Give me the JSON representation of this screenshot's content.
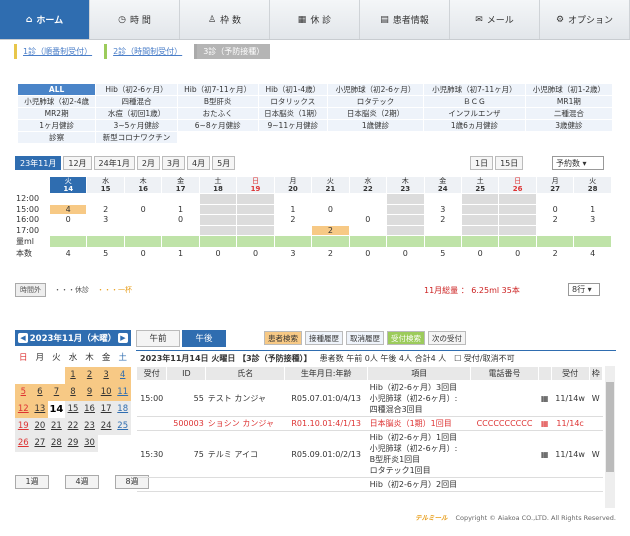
{
  "nav": [
    "ホーム",
    "時 間",
    "枠 数",
    "休 診",
    "患者情報",
    "メール",
    "オプション"
  ],
  "nav_icons": [
    "home-icon",
    "clock-icon",
    "person-icon",
    "calendar-icon",
    "card-icon",
    "mail-icon",
    "gear-icon"
  ],
  "subtabs": [
    "1診（順番制受付）",
    "2診（時間制受付）",
    "3診（予防接種）"
  ],
  "vaccines": [
    [
      "ALL",
      "Hib（初2-6ヶ月）",
      "Hib（初7-11ヶ月）",
      "Hib（初1-4歳）",
      "小児肺球（初2-6ヶ月）",
      "小児肺球（初7-11ヶ月）",
      "小児肺球（初1-2歳）"
    ],
    [
      "小児肺球（初2-4歳",
      "四種混合",
      "B型肝炎",
      "ロタリックス",
      "ロタテック",
      "ＢＣＧ",
      "MR1期"
    ],
    [
      "MR2期",
      "水痘（初回1歳）",
      "おたふく",
      "日本脳炎（1期）",
      "日本脳炎（2期）",
      "インフルエンザ",
      "二種混合"
    ],
    [
      "1ヶ月健診",
      "3~5ヶ月健診",
      "6~8ヶ月健診",
      "9~11ヶ月健診",
      "1歳健診",
      "1歳6ヵ月健診",
      "3歳健診"
    ],
    [
      "診察",
      "新型コロナワクチン",
      "",
      "",
      "",
      "",
      ""
    ]
  ],
  "months": [
    "23年11月",
    "12月",
    "24年1月",
    "2月",
    "3月",
    "4月",
    "5月"
  ],
  "range_buttons": [
    "1日",
    "15日"
  ],
  "view_select": "予約数",
  "sched_days": [
    {
      "w": "火",
      "d": "14"
    },
    {
      "w": "水",
      "d": "15"
    },
    {
      "w": "木",
      "d": "16"
    },
    {
      "w": "金",
      "d": "17"
    },
    {
      "w": "土",
      "d": "18"
    },
    {
      "w": "日",
      "d": "19"
    },
    {
      "w": "月",
      "d": "20"
    },
    {
      "w": "火",
      "d": "21"
    },
    {
      "w": "水",
      "d": "22"
    },
    {
      "w": "木",
      "d": "23"
    },
    {
      "w": "金",
      "d": "24"
    },
    {
      "w": "土",
      "d": "25"
    },
    {
      "w": "日",
      "d": "26"
    },
    {
      "w": "月",
      "d": "27"
    },
    {
      "w": "火",
      "d": "28"
    }
  ],
  "sched_rows": [
    {
      "t": "12:00",
      "v": [
        "",
        "",
        "",
        "",
        "",
        "",
        "",
        "",
        "",
        "",
        "",
        "",
        "",
        "",
        ""
      ]
    },
    {
      "t": "15:00",
      "v": [
        "4",
        "2",
        "0",
        "1",
        "",
        "",
        "1",
        "0",
        "",
        "",
        "3",
        "",
        "",
        "0",
        "1"
      ]
    },
    {
      "t": "16:00",
      "v": [
        "0",
        "3",
        "",
        "0",
        "",
        "",
        "2",
        "",
        "0",
        "",
        "2",
        "",
        "",
        "2",
        "3"
      ]
    },
    {
      "t": "17:00",
      "v": [
        "",
        "",
        "",
        "",
        "",
        "",
        "",
        "2",
        "",
        "",
        "",
        "",
        "",
        "",
        ""
      ]
    },
    {
      "t": "量ml",
      "v": [
        "",
        "",
        "",
        "",
        "",
        "",
        "",
        "",
        "",
        "",
        "",
        "",
        "",
        "",
        ""
      ]
    },
    {
      "t": "本数",
      "v": [
        "4",
        "5",
        "0",
        "1",
        "0",
        "0",
        "3",
        "2",
        "0",
        "0",
        "5",
        "0",
        "0",
        "2",
        "4"
      ]
    }
  ],
  "legend": [
    "時間外",
    "・・・休診",
    "・・・一杯"
  ],
  "total": "11月総量 ： 6.25ml 35本",
  "row_select": "8行",
  "calendar": {
    "title": "2023年11月（木曜）",
    "weekdays": [
      "日",
      "月",
      "火",
      "水",
      "木",
      "金",
      "土"
    ],
    "days": [
      "",
      "",
      "",
      "1",
      "2",
      "3",
      "4",
      "5",
      "6",
      "7",
      "8",
      "9",
      "10",
      "11",
      "12",
      "13",
      "14",
      "15",
      "16",
      "17",
      "18",
      "19",
      "20",
      "21",
      "22",
      "23",
      "24",
      "25",
      "26",
      "27",
      "28",
      "29",
      "30",
      "",
      ""
    ]
  },
  "cal_buttons": [
    "1週",
    "4週",
    "8週"
  ],
  "period_tabs": [
    "午前",
    "午後"
  ],
  "history_buttons": [
    "患者検索",
    "接種履歴",
    "取消履歴",
    "受付検索",
    "次の受付"
  ],
  "info": {
    "date": "2023年11月14日 火曜日 【3診（予防接種）】",
    "count": "患者数 午前 0人 午後 4人 合計4 人",
    "checkbox": "受付/取消不可"
  },
  "table_headers": [
    "受付",
    "ID",
    "氏名",
    "生年月日:年齢",
    "項目",
    "電話番号",
    "",
    "受付",
    "枠"
  ],
  "patients": [
    {
      "time": "15:00",
      "id": "55",
      "name": "テスト カンジャ",
      "birth": "R05.07.01:0/4/13",
      "items": [
        "Hib（初2-6ヶ月）3回目",
        "小児肺球（初2-6ヶ月）:",
        "四種混合3回目"
      ],
      "tel": "",
      "rec": "11/14w",
      "w": "W",
      "red": false
    },
    {
      "time": "",
      "id": "500003",
      "name": "ショシン カンジャ",
      "birth": "R01.10.01:4/1/13",
      "items": [
        "日本脳炎（1期）1回目"
      ],
      "tel": "CCCCCCCCCC",
      "rec": "11/14c",
      "w": "",
      "red": true
    },
    {
      "time": "15:30",
      "id": "75",
      "name": "テルミ アイコ",
      "birth": "R05.09.01:0/2/13",
      "items": [
        "Hib（初2-6ヶ月）1回目",
        "小児肺球（初2-6ヶ月）:",
        "B型肝炎1回目",
        "ロタテック1回目"
      ],
      "tel": "",
      "rec": "11/14w",
      "w": "W",
      "red": false
    },
    {
      "time": "",
      "id": "",
      "name": "",
      "birth": "",
      "items": [
        "Hib（初2-6ヶ月）2回目"
      ],
      "tel": "",
      "rec": "",
      "w": "",
      "red": false
    }
  ],
  "footer": {
    "brand": "テルミール",
    "copy": "Copyright © Aiakoa CO.,LTD. All Rights Reserved."
  }
}
